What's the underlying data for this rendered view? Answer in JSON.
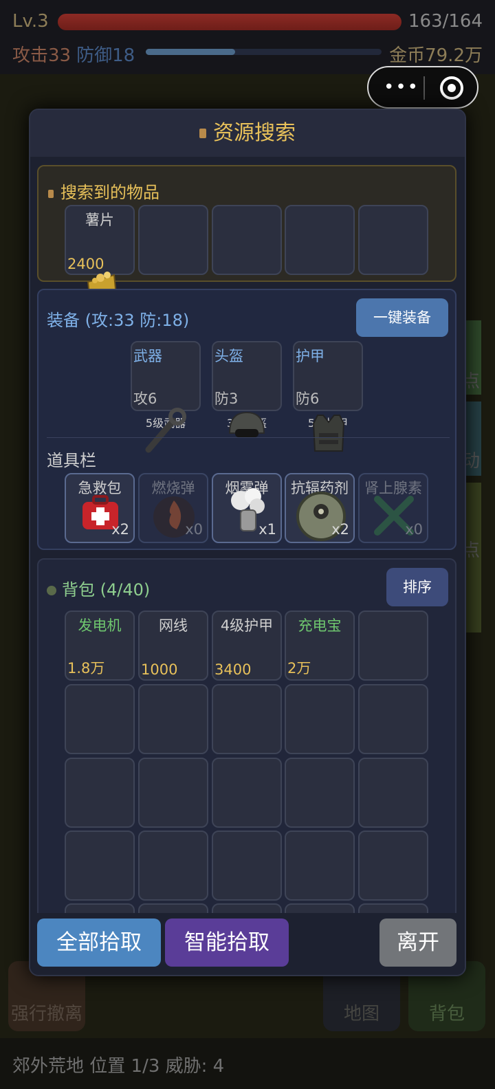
{
  "hud": {
    "level": "Lv.3",
    "hp_text": "163/164",
    "attack": "攻击33",
    "defense": "防御18",
    "gold": "金币79.2万",
    "hp_fraction": 0.994,
    "xp_fraction": 0.38
  },
  "miniprogram": {
    "more_icon": "more-dots-icon",
    "close_icon": "target-icon"
  },
  "background": {
    "evacuate_label": "强行撤离",
    "map_label": "地图",
    "backpack_label": "背包",
    "side_label_1": "点",
    "side_label_2": "动",
    "side_label_3": "点",
    "status": "郊外荒地  位置 1/3  威胁: 4"
  },
  "modal": {
    "title": "资源搜索",
    "found": {
      "title": "搜索到的物品",
      "items": [
        {
          "name": "薯片",
          "value": "2400",
          "icon": "chips-bag-icon"
        },
        {
          "name": "",
          "value": ""
        },
        {
          "name": "",
          "value": ""
        },
        {
          "name": "",
          "value": ""
        },
        {
          "name": "",
          "value": ""
        }
      ]
    },
    "equipment": {
      "title": "装备 (攻:33 防:18)",
      "equip_all_label": "一键装备",
      "slots": [
        {
          "name": "武器",
          "stat": "攻6",
          "label": "5级武器",
          "icon": "wrench-icon"
        },
        {
          "name": "头盔",
          "stat": "防3",
          "label": "3级头盔",
          "icon": "helmet-icon"
        },
        {
          "name": "护甲",
          "stat": "防6",
          "label": "5级护甲",
          "icon": "vest-icon"
        }
      ],
      "tools_title": "道具栏",
      "tools": [
        {
          "name": "急救包",
          "count": "x2",
          "icon": "first-aid-icon",
          "active": true
        },
        {
          "name": "燃烧弹",
          "count": "x0",
          "icon": "fire-bomb-icon",
          "active": false
        },
        {
          "name": "烟雾弹",
          "count": "x1",
          "icon": "smoke-grenade-icon",
          "active": true
        },
        {
          "name": "抗辐药剂",
          "count": "x2",
          "icon": "radiation-shield-icon",
          "active": true
        },
        {
          "name": "肾上腺素",
          "count": "x0",
          "icon": "syringe-icon",
          "active": false
        }
      ]
    },
    "backpack": {
      "title": "背包 (4/40)",
      "sort_label": "排序",
      "items": [
        {
          "name": "发电机",
          "value": "1.8万",
          "rare": true
        },
        {
          "name": "网线",
          "value": "1000",
          "rare": false
        },
        {
          "name": "4级护甲",
          "value": "3400",
          "rare": false
        },
        {
          "name": "充电宝",
          "value": "2万",
          "rare": true
        }
      ]
    },
    "actions": {
      "pick_all": "全部拾取",
      "smart_pick": "智能拾取",
      "leave": "离开"
    }
  },
  "colors": {
    "accent_gold": "#e8c15a",
    "equip_blue": "#7fb1e8",
    "rare_green": "#6fc86f",
    "hp_red": "#8c2a24"
  }
}
